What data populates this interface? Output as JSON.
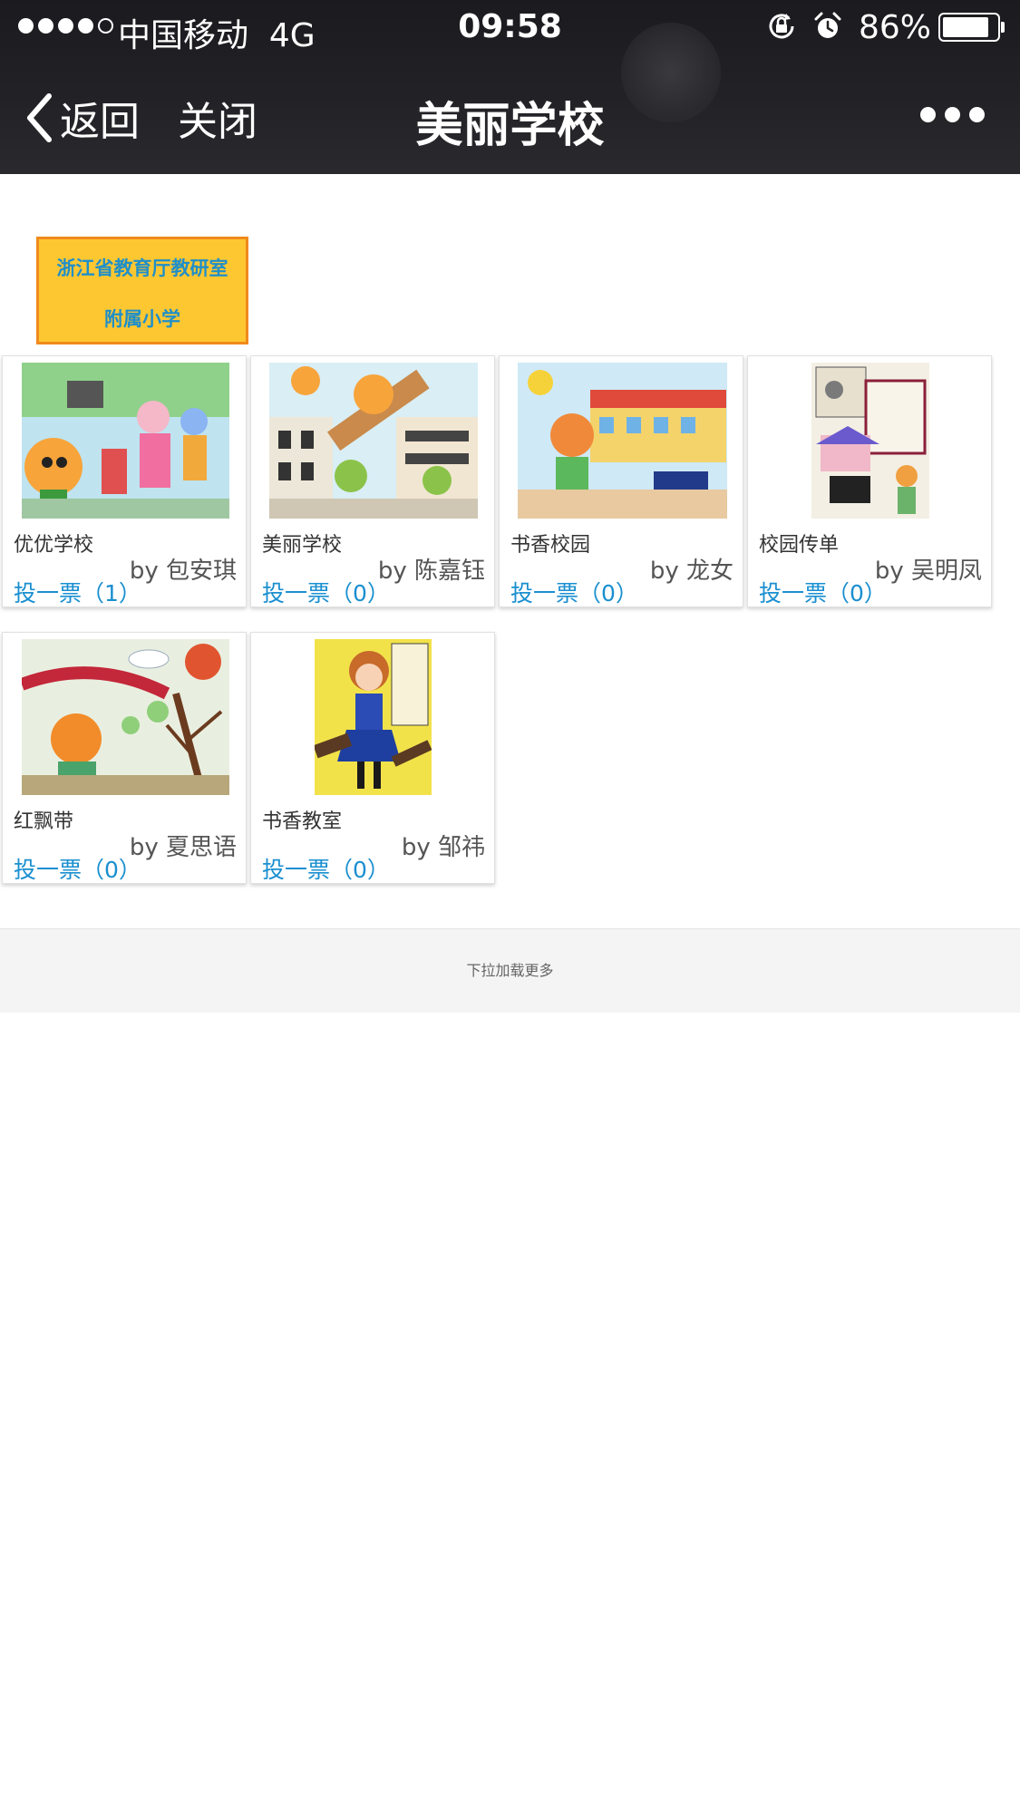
{
  "status_bar": {
    "carrier": "中国移动",
    "network": "4G",
    "time": "09:58",
    "battery": "86%",
    "battery_level": 0.86
  },
  "nav": {
    "back_label": "返回",
    "close_label": "关闭",
    "title": "美丽学校"
  },
  "school": {
    "line1": "浙江省教育厅教研室",
    "line2": "附属小学"
  },
  "works": [
    {
      "title": "优优学校",
      "author": "by 包安琪",
      "vote": "投一票（1）"
    },
    {
      "title": "美丽学校",
      "author": "by 陈嘉钰",
      "vote": "投一票（0）"
    },
    {
      "title": "书香校园",
      "author": "by 龙女",
      "vote": "投一票（0）"
    },
    {
      "title": "校园传单",
      "author": "by 吴明凤",
      "vote": "投一票（0）"
    },
    {
      "title": "红飘带",
      "author": "by 夏思语",
      "vote": "投一票（0）"
    },
    {
      "title": "书香教室",
      "author": "by 邹祎",
      "vote": "投一票（0）"
    }
  ],
  "footer": {
    "load_more": "下拉加载更多"
  },
  "colors": {
    "vote_link": "#1a8fd0",
    "badge_bg": "#fdc731",
    "badge_border": "#f08a1c",
    "badge_text": "#1f8fc9"
  }
}
